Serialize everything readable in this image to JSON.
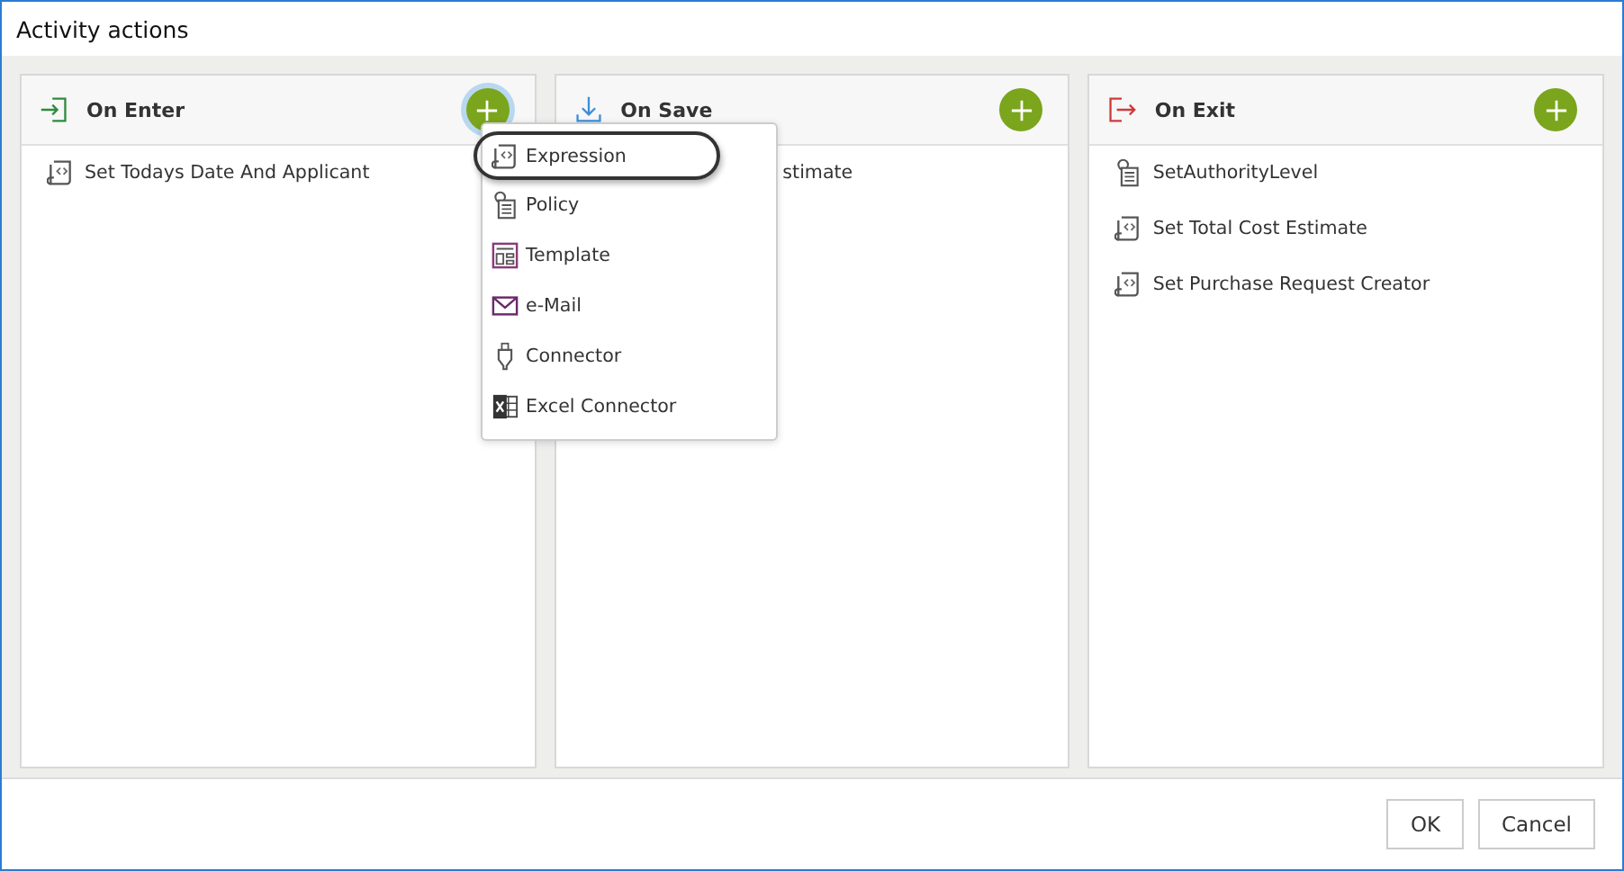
{
  "window": {
    "title": "Activity actions"
  },
  "panels": [
    {
      "title": "On Enter",
      "kind": "enter",
      "add_focused": true,
      "items": [
        {
          "label": "Set Todays Date And Applicant",
          "kind": "expression"
        }
      ]
    },
    {
      "title": "On Save",
      "kind": "save",
      "add_focused": false,
      "items": [
        {
          "label": "stimate",
          "kind": "covered"
        }
      ]
    },
    {
      "title": "On Exit",
      "kind": "exit",
      "add_focused": false,
      "items": [
        {
          "label": "SetAuthorityLevel",
          "kind": "policy"
        },
        {
          "label": "Set Total Cost Estimate",
          "kind": "expression"
        },
        {
          "label": "Set Purchase Request Creator",
          "kind": "expression"
        }
      ]
    }
  ],
  "menu": {
    "items": [
      {
        "label": "Expression",
        "kind": "expression",
        "circled": true
      },
      {
        "label": "Policy",
        "kind": "policy",
        "circled": false
      },
      {
        "label": "Template",
        "kind": "template",
        "circled": false
      },
      {
        "label": "e-Mail",
        "kind": "mail",
        "circled": false
      },
      {
        "label": "Connector",
        "kind": "connector",
        "circled": false
      },
      {
        "label": "Excel Connector",
        "kind": "excel",
        "circled": false
      }
    ]
  },
  "buttons": [
    "OK",
    "Cancel"
  ]
}
